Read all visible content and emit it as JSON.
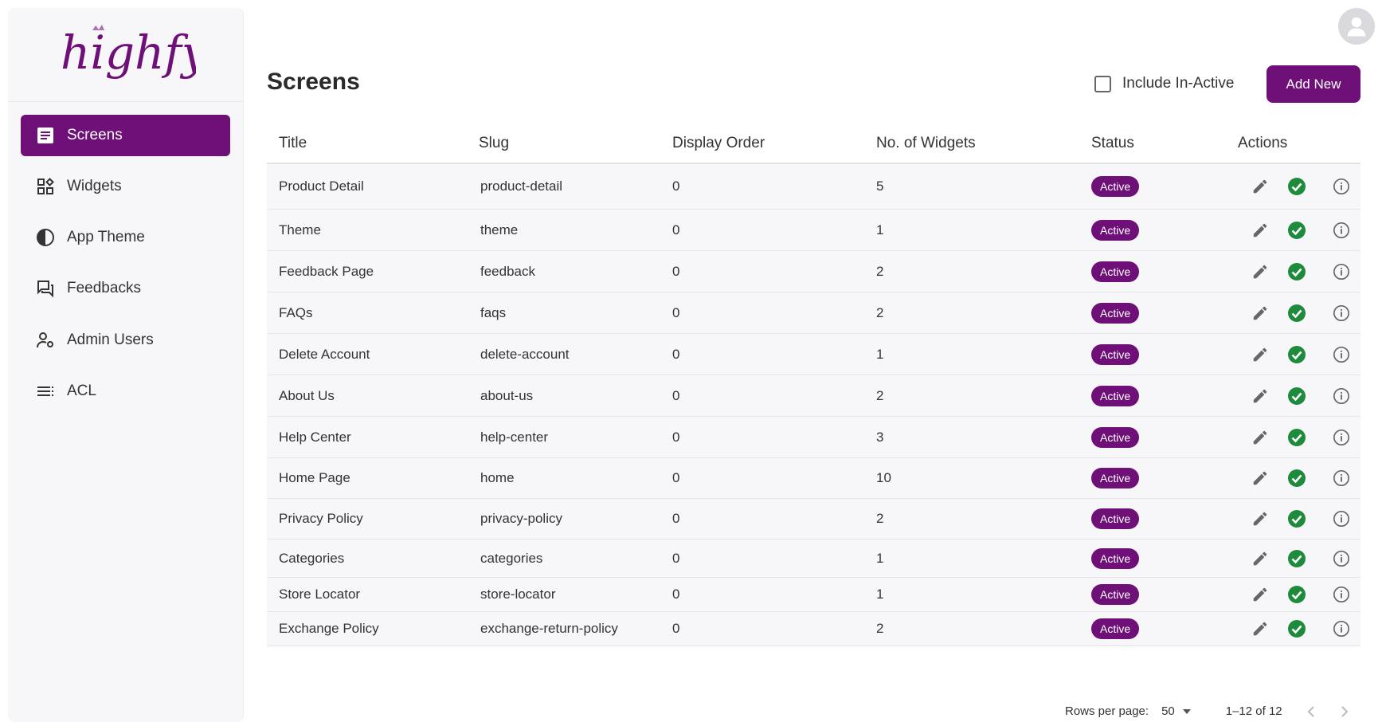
{
  "app": {
    "brand": "highfy"
  },
  "sidebar": {
    "items": [
      {
        "label": "Screens",
        "icon": "document-icon",
        "active": true
      },
      {
        "label": "Widgets",
        "icon": "widgets-icon"
      },
      {
        "label": "App Theme",
        "icon": "contrast-icon"
      },
      {
        "label": "Feedbacks",
        "icon": "chat-icon"
      },
      {
        "label": "Admin Users",
        "icon": "admin-user-icon"
      },
      {
        "label": "ACL",
        "icon": "list-icon"
      }
    ]
  },
  "header": {
    "title": "Screens",
    "include_inactive_label": "Include In-Active",
    "include_inactive_checked": false,
    "add_new_label": "Add New"
  },
  "table": {
    "columns": [
      "Title",
      "Slug",
      "Display Order",
      "No. of Widgets",
      "Status",
      "Actions"
    ],
    "rows": [
      {
        "title": "Product Detail",
        "slug": "product-detail",
        "order": "0",
        "widgets": "5",
        "status": "Active"
      },
      {
        "title": "Theme",
        "slug": "theme",
        "order": "0",
        "widgets": "1",
        "status": "Active"
      },
      {
        "title": "Feedback Page",
        "slug": "feedback",
        "order": "0",
        "widgets": "2",
        "status": "Active"
      },
      {
        "title": "FAQs",
        "slug": "faqs",
        "order": "0",
        "widgets": "2",
        "status": "Active"
      },
      {
        "title": "Delete Account",
        "slug": "delete-account",
        "order": "0",
        "widgets": "1",
        "status": "Active"
      },
      {
        "title": "About Us",
        "slug": "about-us",
        "order": "0",
        "widgets": "2",
        "status": "Active"
      },
      {
        "title": "Help Center",
        "slug": "help-center",
        "order": "0",
        "widgets": "3",
        "status": "Active"
      },
      {
        "title": "Home Page",
        "slug": "home",
        "order": "0",
        "widgets": "10",
        "status": "Active"
      },
      {
        "title": "Privacy Policy",
        "slug": "privacy-policy",
        "order": "0",
        "widgets": "2",
        "status": "Active"
      },
      {
        "title": "Categories",
        "slug": "categories",
        "order": "0",
        "widgets": "1",
        "status": "Active"
      },
      {
        "title": "Store Locator",
        "slug": "store-locator",
        "order": "0",
        "widgets": "1",
        "status": "Active"
      },
      {
        "title": "Exchange Policy",
        "slug": "exchange-return-policy",
        "order": "0",
        "widgets": "2",
        "status": "Active"
      }
    ]
  },
  "pagination": {
    "rows_per_page_label": "Rows per page:",
    "rows_per_page_value": "50",
    "range_text": "1–12 of 12"
  },
  "colors": {
    "brand": "#6f0f78",
    "success": "#1e8b3c"
  }
}
